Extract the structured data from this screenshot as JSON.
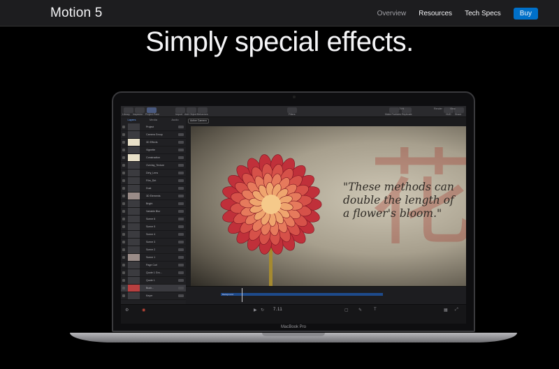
{
  "nav": {
    "brand": "Motion 5",
    "links": [
      "Overview",
      "Resources",
      "Tech Specs"
    ],
    "buy": "Buy"
  },
  "hero": {
    "title": "Simply special effects."
  },
  "device": {
    "label": "MacBook Pro"
  },
  "app": {
    "toolbar_left": [
      "Library",
      "Inspector",
      "Project Pane",
      "Import",
      "Add Object",
      "Behaviors"
    ],
    "toolbar_center": "Filters",
    "toolbar_right": [
      "Make Particles",
      "Replicate",
      "HUD",
      "Share"
    ],
    "zoom": "75%",
    "render_label": "Render",
    "view_label": "View",
    "panel_tabs": [
      "Layers",
      "Media",
      "Audio"
    ],
    "camera_select": "Active Camera",
    "layers": [
      "Project",
      "Camera Group",
      "3D Effects",
      "Vignette",
      "Constraction",
      "Overlay_Texture",
      "Dirty_Lens",
      "Film_Dirt",
      "Dust",
      "3D Elements",
      "Bright",
      "Variable Blur",
      "Scene 6",
      "Scene 5",
      "Scene 4",
      "Scene 3",
      "Scene 2",
      "Scene 1",
      "Page Curl",
      "Quote 1 Gro...",
      "Quote 1",
      "Bush...",
      "Keyer"
    ],
    "canvas_quote": "\"These methods can double the length of a flower's bloom.\"",
    "kanji": "花",
    "timeline_clip": "Background",
    "timecode": "7.11"
  }
}
